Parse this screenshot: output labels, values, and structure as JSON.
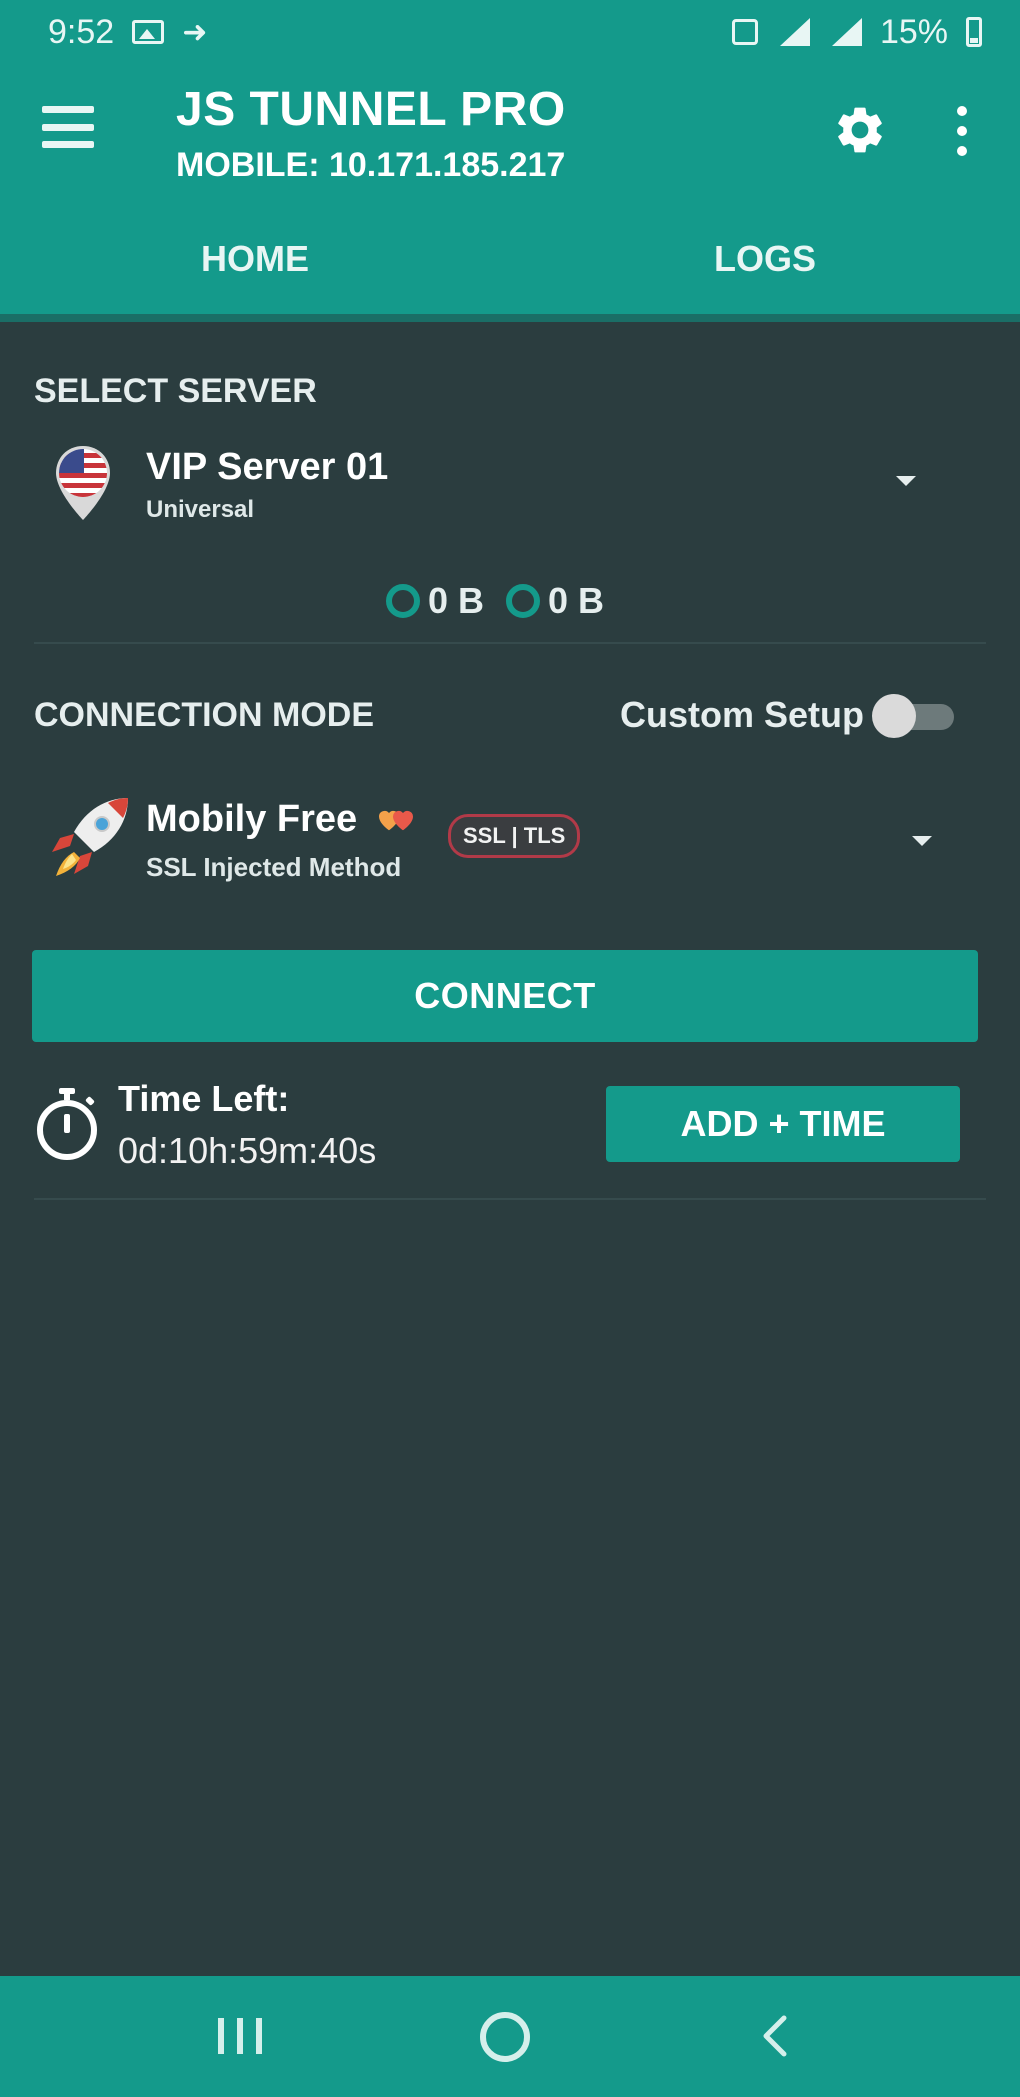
{
  "status_bar": {
    "time": "9:52",
    "battery": "15%"
  },
  "app_bar": {
    "title": "JS TUNNEL PRO",
    "subtitle": "MOBILE: 10.171.185.217"
  },
  "tabs": [
    {
      "label": "HOME",
      "active": true
    },
    {
      "label": "LOGS",
      "active": false
    }
  ],
  "server": {
    "section_label": "SELECT SERVER",
    "name": "VIP Server 01",
    "sub": "Universal"
  },
  "stats": {
    "download": "0 B",
    "upload": "0 B"
  },
  "connection": {
    "section_label": "CONNECTION MODE",
    "custom_setup_label": "Custom Setup",
    "custom_setup_on": false,
    "mode_name": "Mobily Free",
    "mode_badge": "SSL | TLS",
    "mode_sub": "SSL Injected Method"
  },
  "connect_label": "CONNECT",
  "timer": {
    "label": "Time Left:",
    "value": "0d:10h:59m:40s",
    "add_time_label": "ADD + TIME"
  },
  "colors": {
    "accent": "#149a8b",
    "background": "#2b3d3f"
  },
  "icons": {
    "menu": "menu-icon",
    "settings": "gear-icon",
    "more": "more-vert-icon",
    "flag_pin": "us-flag-pin-icon",
    "rocket": "rocket-icon",
    "timer": "stopwatch-icon"
  }
}
